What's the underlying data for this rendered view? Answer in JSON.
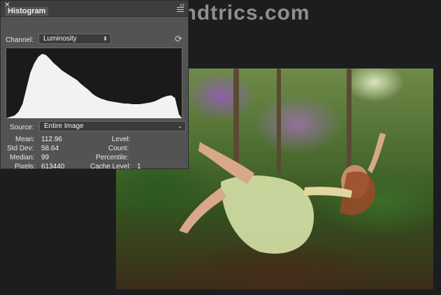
{
  "watermark": "tipsandtrics.com",
  "panel": {
    "tab_title": "Histogram",
    "channel_label": "Channel:",
    "channel_value": "Luminosity",
    "source_label": "Source:",
    "source_value": "Entire Image"
  },
  "stats": {
    "mean_label": "Mean:",
    "mean_value": "112.96",
    "stddev_label": "Std Dev:",
    "stddev_value": "58.64",
    "median_label": "Median:",
    "median_value": "99",
    "pixels_label": "Pixels:",
    "pixels_value": "613440",
    "level_label": "Level:",
    "count_label": "Count:",
    "percentile_label": "Percentile:",
    "cache_label": "Cache Level:",
    "cache_value": "1"
  },
  "histogram_shape": [
    0.02,
    0.08,
    0.2,
    0.45,
    0.7,
    0.85,
    0.95,
    1.0,
    0.98,
    0.92,
    0.85,
    0.8,
    0.74,
    0.7,
    0.66,
    0.62,
    0.58,
    0.52,
    0.47,
    0.42,
    0.36,
    0.32,
    0.29,
    0.27,
    0.25,
    0.24,
    0.23,
    0.22,
    0.21,
    0.21,
    0.2,
    0.2,
    0.2,
    0.21,
    0.22,
    0.23,
    0.25,
    0.28,
    0.31,
    0.33,
    0.34,
    0.3,
    0.04
  ],
  "colors": {
    "panel_bg": "#535353",
    "header_bg": "#3e3e3e",
    "histogram_fill": "#f2f2f2"
  }
}
